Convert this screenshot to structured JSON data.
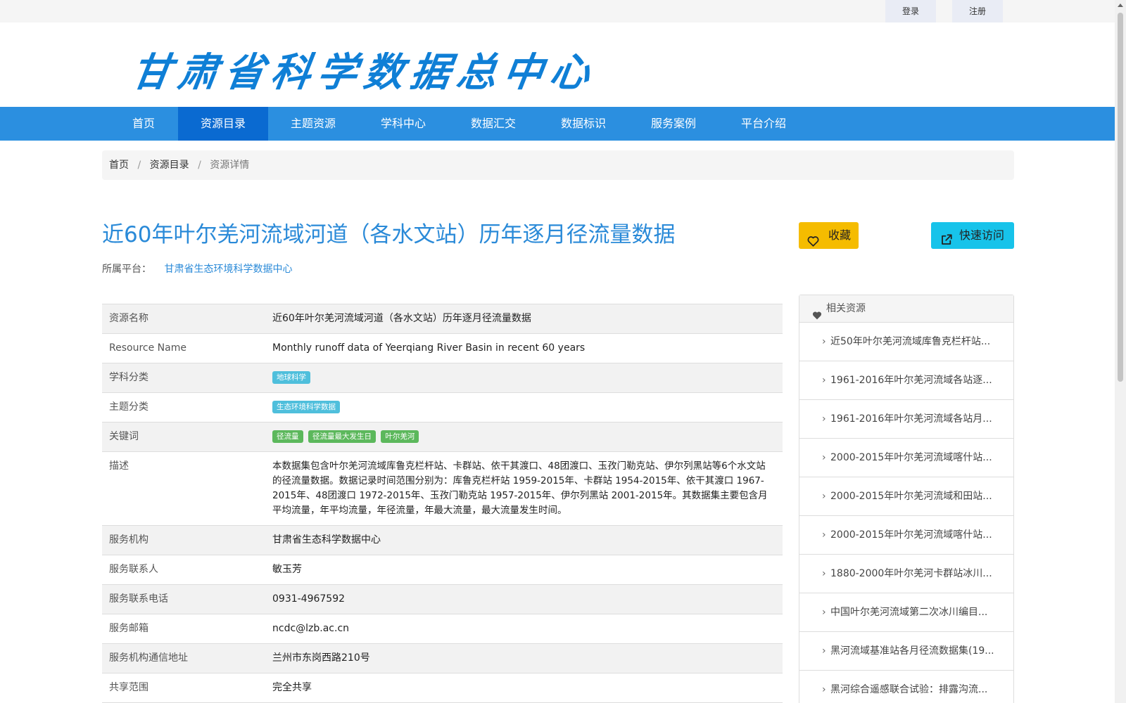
{
  "topbar": {
    "login": "登录",
    "register": "注册"
  },
  "header": {
    "logo_text": "甘肃省科学数据总中心"
  },
  "nav": {
    "items": [
      {
        "label": "首页"
      },
      {
        "label": "资源目录"
      },
      {
        "label": "主题资源"
      },
      {
        "label": "学科中心"
      },
      {
        "label": "数据汇交"
      },
      {
        "label": "数据标识"
      },
      {
        "label": "服务案例"
      },
      {
        "label": "平台介绍"
      }
    ],
    "active": "资源目录"
  },
  "breadcrumb": {
    "home": "首页",
    "catalog": "资源目录",
    "current": "资源详情",
    "separator": "/"
  },
  "resource": {
    "title": "近60年叶尔羌河流域河道（各水文站）历年逐月径流量数据",
    "platform_label": "所属平台：",
    "platform_link": "甘肃省生态环境科学数据中心",
    "favorite_label": "收藏",
    "quick_access_label": "快速访问"
  },
  "info": {
    "name_label": "资源名称",
    "name_value": "近60年叶尔羌河流域河道（各水文站）历年逐月径流量数据",
    "en_label": "Resource Name",
    "en_value": "Monthly runoff data of Yeerqiang River Basin in recent 60 years",
    "discipline_label": "学科分类",
    "discipline_tag": "地球科学",
    "theme_label": "主题分类",
    "theme_tag": "生态环境科学数据",
    "keywords_label": "关键词",
    "keywords": [
      "径流量",
      "径流量最大发生日",
      "叶尔羌河"
    ],
    "desc_label": "描述",
    "desc_value": "本数据集包含叶尔羌河流域库鲁克栏杆站、卡群站、依干其渡口、48团渡口、玉孜门勒克站、伊尔列黑站等6个水文站的径流量数据。数据记录时间范围分别为：库鲁克栏杆站 1959-2015年、卡群站 1954-2015年、依干其渡口 1967-2015年、48团渡口 1972-2015年、玉孜门勒克站 1957-2015年、伊尔列黑站 2001-2015年。其数据集主要包含月平均流量，年平均流量，年径流量，年最大流量，最大流量发生时间。",
    "org_label": "服务机构",
    "org_value": "甘肃省生态科学数据中心",
    "contact_label": "服务联系人",
    "contact_value": "敏玉芳",
    "phone_label": "服务联系电话",
    "phone_value": "0931-4967592",
    "email_label": "服务邮箱",
    "email_value": "ncdc@lzb.ac.cn",
    "address_label": "服务机构通信地址",
    "address_value": "兰州市东岗西路210号",
    "share_label": "共享范围",
    "share_value": "完全共享"
  },
  "related": {
    "heading": "相关资源",
    "items": [
      "近50年叶尔羌河流域库鲁克栏杆站...",
      "1961-2016年叶尔羌河流域各站逐...",
      "1961-2016年叶尔羌河流域各站月...",
      "2000-2015年叶尔羌河流域喀什站...",
      "2000-2015年叶尔羌河流域和田站...",
      "2000-2015年叶尔羌河流域喀什站...",
      "1880-2000年叶尔羌河卡群站冰川...",
      "中国叶尔羌河流域第二次冰川编目...",
      "黑河流域基准站各月径流数据集(19...",
      "黑河综合遥感联合试验：排露沟流..."
    ]
  },
  "colors": {
    "brand_blue": "#2a8ad8",
    "nav_bg": "#2b8fe0",
    "nav_active": "#0a6ad1",
    "favorite_btn": "#f5bc00",
    "quick_access_btn": "#17c3ea",
    "tag_blue": "#4fbfdc",
    "tag_green": "#5cb85c"
  }
}
